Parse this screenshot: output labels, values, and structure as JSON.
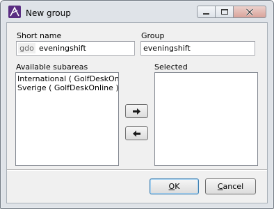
{
  "window": {
    "title": "New group"
  },
  "form": {
    "short_name_label": "Short name",
    "short_name_prefix": "gdo",
    "short_name_value": "eveningshift",
    "group_label": "Group",
    "group_value": "eveningshift",
    "available_label": "Available subareas",
    "selected_label": "Selected",
    "available_items": [
      "International   ( GolfDeskOnline )",
      "Sverige   ( GolfDeskOnline )"
    ],
    "selected_items": []
  },
  "buttons": {
    "ok_label": "OK",
    "cancel_label": "Cancel",
    "ok_mnemonic": "O",
    "cancel_mnemonic": "C"
  },
  "icons": {
    "app": "app-logo-icon",
    "minimize": "minimize-icon",
    "maximize": "maximize-icon",
    "close": "close-icon",
    "add": "arrow-right-icon",
    "remove": "arrow-left-icon"
  },
  "colors": {
    "app_icon_bg": "#5a2d82",
    "close_button": "#d9a39a",
    "focus_border": "#5a9fd4"
  }
}
